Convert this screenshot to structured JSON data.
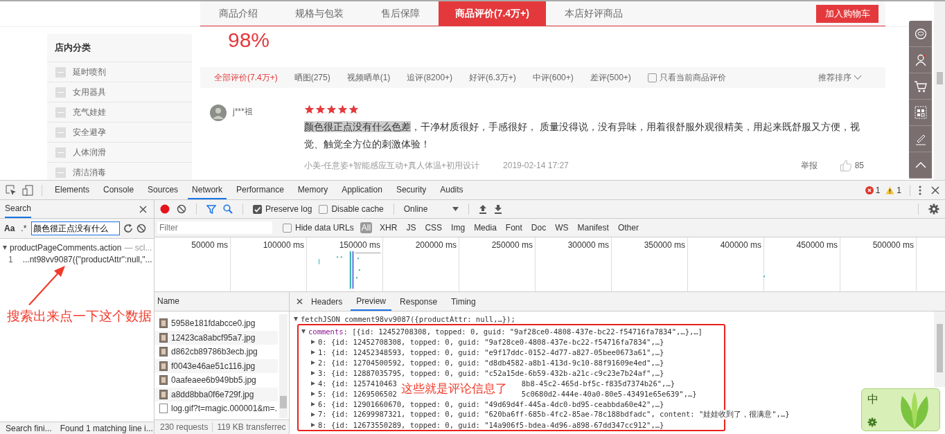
{
  "shop_page": {
    "nav_tabs": [
      {
        "label": "商品介绍",
        "selected": false
      },
      {
        "label": "规格与包装",
        "selected": false
      },
      {
        "label": "售后保障",
        "selected": false
      },
      {
        "label": "商品评价(7.4万+)",
        "selected": true
      },
      {
        "label": "本店好评商品",
        "selected": false
      }
    ],
    "add_to_cart": "加入购物车",
    "rating_percent": "98%",
    "sidebar": {
      "title": "店内分类",
      "items": [
        "延时喷剂",
        "女用器具",
        "充气娃娃",
        "安全避孕",
        "人体润滑",
        "清洁消毒"
      ]
    },
    "filters": [
      {
        "label": "全部评价(7.4万+)",
        "selected": true
      },
      {
        "label": "晒图(275)",
        "selected": false
      },
      {
        "label": "视频晒单(1)",
        "selected": false
      },
      {
        "label": "追评(8200+)",
        "selected": false
      },
      {
        "label": "好评(6.3万+)",
        "selected": false
      },
      {
        "label": "中评(600+)",
        "selected": false
      },
      {
        "label": "差评(500+)",
        "selected": false
      }
    ],
    "only_current": {
      "label": "只看当前商品评价",
      "checked": false
    },
    "sort": "推荐排序",
    "review": {
      "user": "j***祖",
      "stars": 5,
      "highlighted": "颜色很正点没有什么色差",
      "text": "，干净材质很好，手感很好， 质量没得说，没有异味，用着很舒服外观很精美，用起来既舒服又方便，视觉、触觉全方位的刺激体验！",
      "variant": "小美-任意姿+智能感应互动+真人体温+初用设计",
      "date": "2019-02-14 17:27",
      "report": "举报",
      "likes": "85"
    }
  },
  "devtools": {
    "tabs": [
      {
        "label": "Elements",
        "selected": false
      },
      {
        "label": "Console",
        "selected": false
      },
      {
        "label": "Sources",
        "selected": false
      },
      {
        "label": "Network",
        "selected": true
      },
      {
        "label": "Performance",
        "selected": false
      },
      {
        "label": "Memory",
        "selected": false
      },
      {
        "label": "Application",
        "selected": false
      },
      {
        "label": "Security",
        "selected": false
      },
      {
        "label": "Audits",
        "selected": false
      }
    ],
    "errors": "1",
    "warnings": "1",
    "search": {
      "title": "Search",
      "case_label": "Aa",
      "regex_label": ".*",
      "query": "颜色很正点没有什么",
      "result_file": "productPageComments.action",
      "result_source": "— scl...",
      "expanded": true,
      "line_number": "1",
      "line": "...nt98vv9087({\"productAttr\":null,\"...",
      "status": "Search fini...",
      "found": "Found 1 matching line i..."
    },
    "annotations": [
      "搜索出来点一下这个数据",
      "这些就是评论信息了"
    ],
    "network": {
      "preserve_log": {
        "label": "Preserve log",
        "checked": true
      },
      "disable_cache": {
        "label": "Disable cache",
        "checked": false
      },
      "throttle": "Online",
      "filter_placeholder": "Filter",
      "hide_data_urls": {
        "label": "Hide data URLs",
        "checked": false
      },
      "types": [
        {
          "label": "All",
          "selected": true
        },
        {
          "label": "XHR",
          "selected": false
        },
        {
          "label": "JS",
          "selected": false
        },
        {
          "label": "CSS",
          "selected": false
        },
        {
          "label": "Img",
          "selected": false
        },
        {
          "label": "Media",
          "selected": false
        },
        {
          "label": "Font",
          "selected": false
        },
        {
          "label": "Doc",
          "selected": false
        },
        {
          "label": "WS",
          "selected": false
        },
        {
          "label": "Manifest",
          "selected": false
        },
        {
          "label": "Other",
          "selected": false
        }
      ],
      "ticks": [
        "50000 ms",
        "100000 ms",
        "150000 ms",
        "200000 ms",
        "250000 ms",
        "300000 ms",
        "350000 ms",
        "400000 ms",
        "450000 ms",
        "500000 ms"
      ],
      "column": "Name",
      "files": [
        {
          "name": "5958e181fdabcce0.jpg",
          "kind": "image"
        },
        {
          "name": "12423ca8abcf95a7.jpg",
          "kind": "image"
        },
        {
          "name": "d862cb89786b3ecb.jpg",
          "kind": "image"
        },
        {
          "name": "f0043e46ae51c116.jpg",
          "kind": "image"
        },
        {
          "name": "0aafeaee6b949bb5.jpg",
          "kind": "image"
        },
        {
          "name": "a8dd8bba0f6e729f.jpg",
          "kind": "image"
        },
        {
          "name": "log.gif?t=magic.000001&m=.",
          "kind": "blank"
        }
      ],
      "requests": "230 requests",
      "transferred": "119 KB transferrec"
    },
    "detail": {
      "tabs": [
        {
          "label": "Headers",
          "selected": false
        },
        {
          "label": "Preview",
          "selected": true
        },
        {
          "label": "Response",
          "selected": false
        },
        {
          "label": "Timing",
          "selected": false
        }
      ],
      "root": {
        "text": "fetchJSON comment98vv9087({productAttr: null,…});",
        "expanded": true
      },
      "comments": {
        "key": "comments",
        "value": ": [{id: 12452708308, topped: 0, guid: \"9af28ce0-4808-437e-bc22-f54716fa7834\",…},…]",
        "expanded": true
      },
      "rows": [
        {
          "kind": "plain",
          "text": "0: {id: 12452708308, topped: 0, guid: \"9af28ce0-4808-437e-bc22-f54716fa7834\",…}",
          "expanded": false
        },
        {
          "kind": "plain",
          "text": "1: {id: 12452348593, topped: 0, guid: \"e9f17ddc-0152-4d77-a827-05bee0673a61\",…}",
          "expanded": false
        },
        {
          "kind": "plain",
          "text": "2: {id: 12704500592, topped: 0, guid: \"d8db4582-a8b1-413d-9c10-88f91609e4ed\",…}",
          "expanded": false
        },
        {
          "kind": "plain",
          "text": "3: {id: 12887035795, topped: 0, guid: \"c52a15de-6b59-432b-a21c-c9c23e7b24af\",…}",
          "expanded": false
        },
        {
          "kind": "covered",
          "text": "4: {id: 1257410463",
          "tail": "8b8-45c2-465d-bf5c-f835d7374b26\",…}",
          "expanded": false
        },
        {
          "kind": "covered",
          "text": "5: {id: 1269506502",
          "tail": "5c0680d2-444e-40a0-80e5-43491e65e639\",…}",
          "expanded": false
        },
        {
          "kind": "plain",
          "text": "6: {id: 12901660670, topped: 0, guid: \"49d69d4f-445a-4dc0-bd95-ceabbda60e42\",…}",
          "expanded": false
        },
        {
          "kind": "plain",
          "text": "7: {id: 12699987321, topped: 0, guid: \"620ba6ff-685b-4fc2-85ae-78c188bdfadc\", content: \"娃娃收到了，很满意\",…}",
          "expanded": false
        },
        {
          "kind": "plain",
          "text": "8: {id: 12673550289, topped: 0, guid: \"14a906f5-bdea-4d96-a898-67dd347cc912\",…}",
          "expanded": false
        }
      ]
    }
  },
  "ime_widget": {
    "label": "中"
  }
}
